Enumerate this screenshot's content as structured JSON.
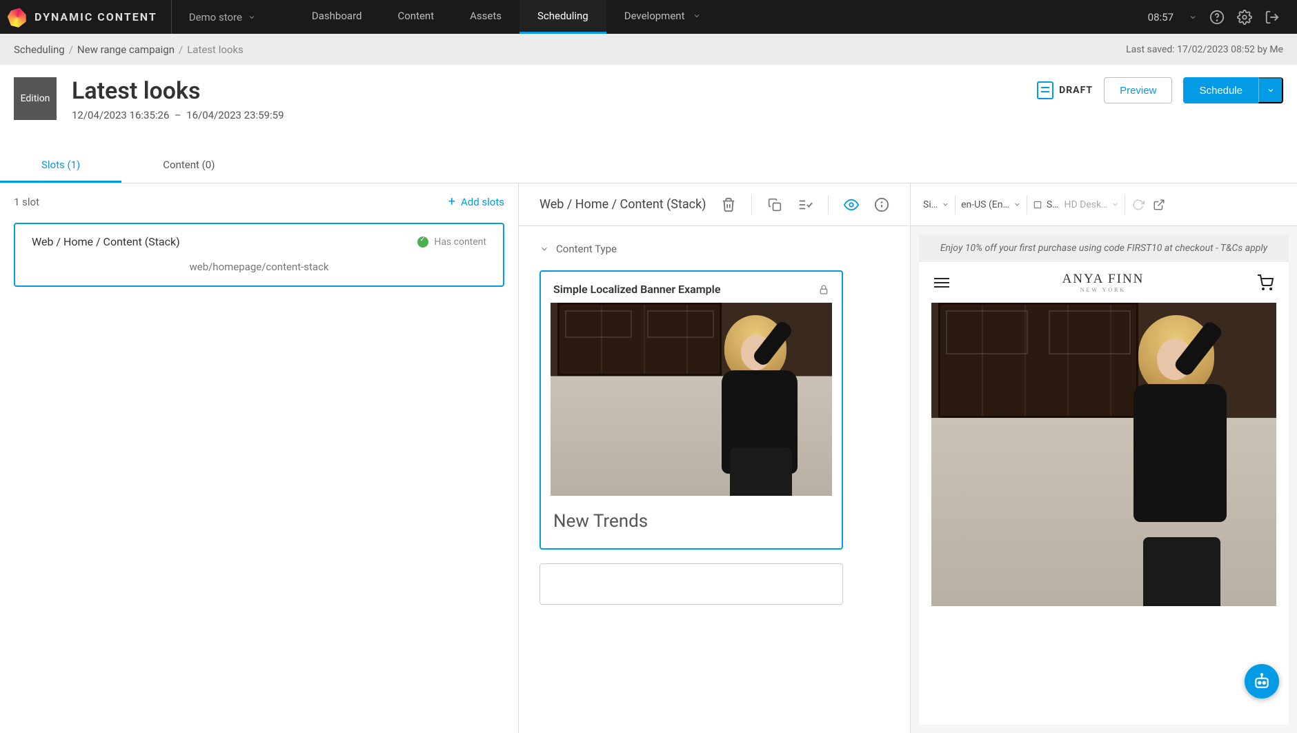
{
  "app": {
    "brand": "DYNAMIC CONTENT",
    "store": "Demo store",
    "time": "08:57"
  },
  "nav": {
    "tabs": [
      {
        "label": "Dashboard"
      },
      {
        "label": "Content"
      },
      {
        "label": "Assets"
      },
      {
        "label": "Scheduling"
      },
      {
        "label": "Development"
      }
    ]
  },
  "breadcrumb": {
    "items": [
      "Scheduling",
      "New range campaign",
      "Latest looks"
    ],
    "last_saved": "Last saved: 17/02/2023 08:52 by Me"
  },
  "header": {
    "badge": "Edition",
    "title": "Latest looks",
    "start": "12/04/2023 16:35:26",
    "dash": "–",
    "end": "16/04/2023 23:59:59",
    "status": "DRAFT",
    "preview_btn": "Preview",
    "schedule_btn": "Schedule"
  },
  "page_tabs": {
    "slots": "Slots (1)",
    "content": "Content (0)"
  },
  "slots": {
    "count_label": "1 slot",
    "add_label": "Add slots",
    "card": {
      "title": "Web / Home / Content (Stack)",
      "status_label": "Has content",
      "path": "web/homepage/content-stack"
    }
  },
  "middle": {
    "title": "Web / Home / Content (Stack)",
    "section_label": "Content Type",
    "card": {
      "title": "Simple Localized Banner Example",
      "caption": "New Trends"
    }
  },
  "preview_toolbar": {
    "mode": "Si…",
    "locale": "en-US (En…",
    "device_short": "S…",
    "device_long": "HD Desk…"
  },
  "preview": {
    "promo": "Enjoy 10% off your first purchase using code FIRST10 at checkout - T&Cs apply",
    "logo_top": "ANYA FINN",
    "logo_sub": "NEW YORK"
  }
}
